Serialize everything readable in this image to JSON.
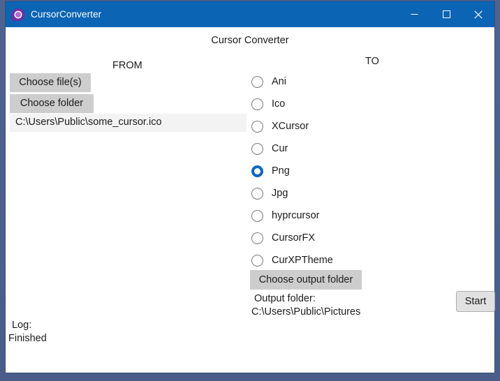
{
  "window": {
    "title": "CursorConverter",
    "icon": "app-cursor-icon",
    "controls": {
      "minimize": "minimize-icon",
      "maximize": "maximize-icon",
      "close": "close-icon"
    },
    "titlebar_color": "#0b64b4",
    "frame_color": "#4c608e"
  },
  "header": {
    "title": "Cursor Converter"
  },
  "from": {
    "label": "FROM",
    "choose_files_label": "Choose file(s)",
    "choose_folder_label": "Choose folder",
    "files": [
      "C:\\Users\\Public\\some_cursor.ico"
    ]
  },
  "to": {
    "label": "TO",
    "selected": "Png",
    "accent_color": "#0b67c9",
    "options": [
      {
        "label": "Ani",
        "selected": false
      },
      {
        "label": "Ico",
        "selected": false
      },
      {
        "label": "XCursor",
        "selected": false
      },
      {
        "label": "Cur",
        "selected": false
      },
      {
        "label": "Png",
        "selected": true
      },
      {
        "label": "Jpg",
        "selected": false
      },
      {
        "label": "hyprcursor",
        "selected": false
      },
      {
        "label": "CursorFX",
        "selected": false
      },
      {
        "label": "CurXPTheme",
        "selected": false
      }
    ]
  },
  "output": {
    "choose_output_folder_label": "Choose output folder",
    "folder_caption": "Output folder:",
    "folder_path": "C:\\Users\\Public\\Pictures"
  },
  "actions": {
    "start_label": "Start"
  },
  "log": {
    "caption": "Log:",
    "lines": [
      "Finished"
    ]
  }
}
